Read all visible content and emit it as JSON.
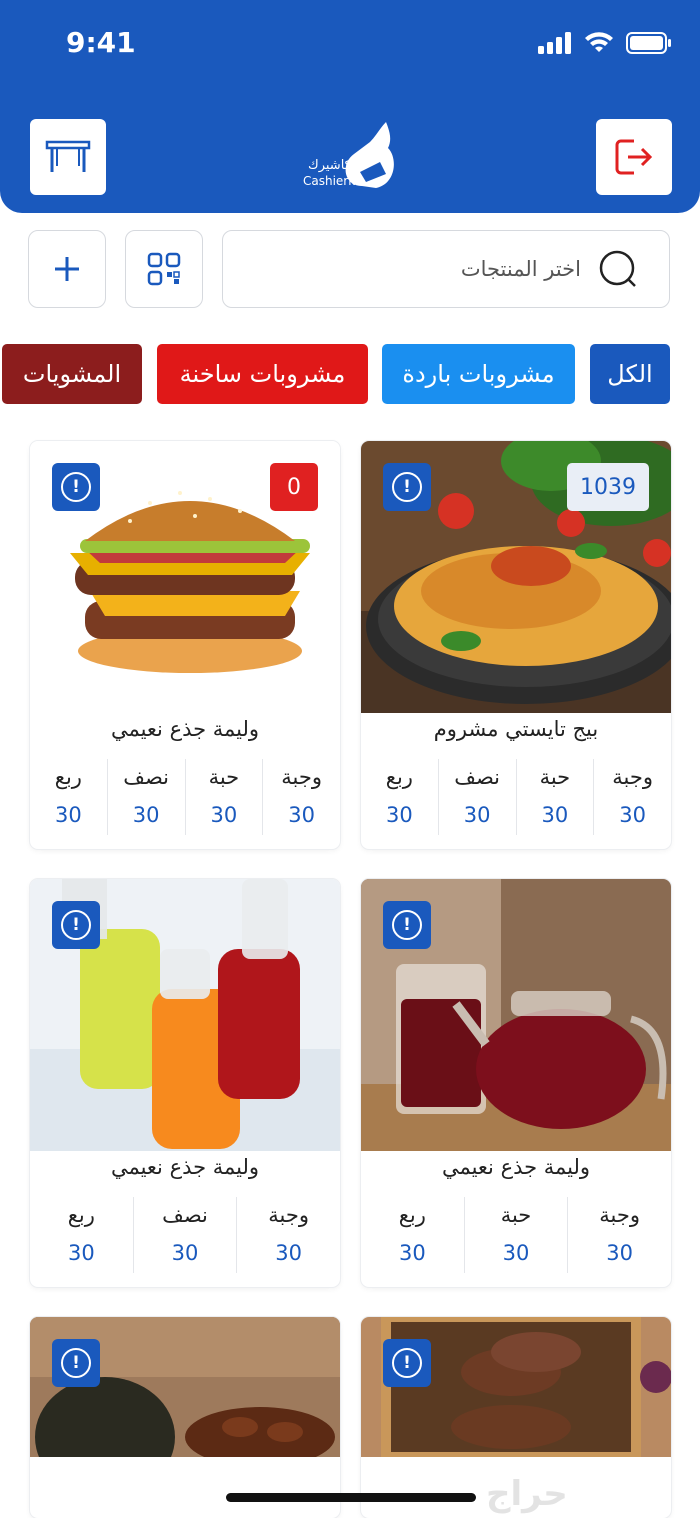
{
  "status_bar": {
    "time": "9:41"
  },
  "header": {
    "logo_ar": "كاشيرك",
    "logo_en": "Cashierk"
  },
  "search": {
    "placeholder": "اختر المنتجات"
  },
  "categories": [
    {
      "label": "الكل",
      "color": "#1a59bd"
    },
    {
      "label": "مشروبات باردة",
      "color": "#1a8ff0"
    },
    {
      "label": "مشروبات ساخنة",
      "color": "#e01818"
    },
    {
      "label": "المشويات",
      "color": "#8c1d1d"
    }
  ],
  "products": [
    {
      "title": "بيج تايستي مشروم",
      "stock": "1039",
      "prices": [
        {
          "label": "وجبة",
          "value": "30"
        },
        {
          "label": "حبة",
          "value": "30"
        },
        {
          "label": "نصف",
          "value": "30"
        },
        {
          "label": "ربع",
          "value": "30"
        }
      ]
    },
    {
      "title": "وليمة جذع نعيمي",
      "stock": "0",
      "prices": [
        {
          "label": "وجبة",
          "value": "30"
        },
        {
          "label": "حبة",
          "value": "30"
        },
        {
          "label": "نصف",
          "value": "30"
        },
        {
          "label": "ربع",
          "value": "30"
        }
      ]
    },
    {
      "title": "وليمة جذع نعيمي",
      "prices": [
        {
          "label": "وجبة",
          "value": "30"
        },
        {
          "label": "حبة",
          "value": "30"
        },
        {
          "label": "ربع",
          "value": "30"
        }
      ]
    },
    {
      "title": "وليمة جذع نعيمي",
      "prices": [
        {
          "label": "وجبة",
          "value": "30"
        },
        {
          "label": "نصف",
          "value": "30"
        },
        {
          "label": "ربع",
          "value": "30"
        }
      ]
    }
  ],
  "watermark": "حراج"
}
